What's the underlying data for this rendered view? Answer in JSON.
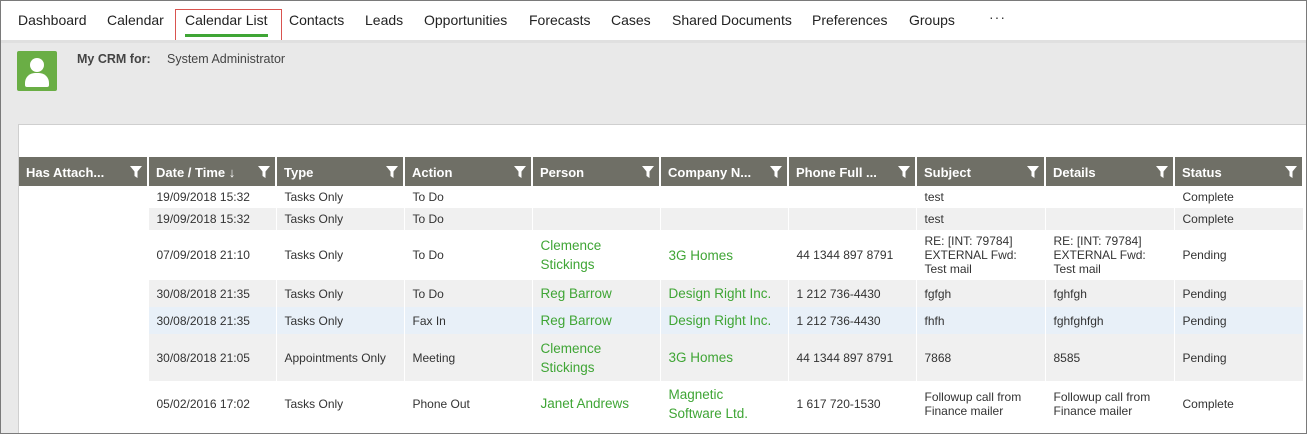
{
  "nav": {
    "items": [
      {
        "label": "Dashboard"
      },
      {
        "label": "Calendar"
      },
      {
        "label": "Calendar List"
      },
      {
        "label": "Contacts"
      },
      {
        "label": "Leads"
      },
      {
        "label": "Opportunities"
      },
      {
        "label": "Forecasts"
      },
      {
        "label": "Cases"
      },
      {
        "label": "Shared Documents"
      },
      {
        "label": "Preferences"
      },
      {
        "label": "Groups"
      }
    ],
    "more": "···",
    "active_color": "#3fa535"
  },
  "header": {
    "crm_label": "My CRM for:",
    "user_name": "System Administrator",
    "avatar_color": "#6aae45"
  },
  "table": {
    "columns": [
      {
        "label": "Has Attach..."
      },
      {
        "label": "Date / Time ↓"
      },
      {
        "label": "Type"
      },
      {
        "label": "Action"
      },
      {
        "label": "Person"
      },
      {
        "label": "Company N..."
      },
      {
        "label": "Phone Full ..."
      },
      {
        "label": "Subject"
      },
      {
        "label": "Details"
      },
      {
        "label": "Status"
      }
    ],
    "rows": [
      {
        "date": "19/09/2018 15:32",
        "type": "Tasks Only",
        "action": "To Do",
        "person": "",
        "company": "",
        "phone": "",
        "subject": "test",
        "details": "",
        "status": "Complete"
      },
      {
        "date": "19/09/2018 15:32",
        "type": "Tasks Only",
        "action": "To Do",
        "person": "",
        "company": "",
        "phone": "",
        "subject": "test",
        "details": "",
        "status": "Complete"
      },
      {
        "date": "07/09/2018 21:10",
        "type": "Tasks Only",
        "action": "To Do",
        "person": "Clemence Stickings",
        "company": "3G Homes",
        "phone": "44 1344 897 8791",
        "subject": "RE: [INT: 79784] EXTERNAL Fwd: Test mail",
        "details": "RE: [INT: 79784] EXTERNAL Fwd: Test mail",
        "status": "Pending"
      },
      {
        "date": "30/08/2018 21:35",
        "type": "Tasks Only",
        "action": "To Do",
        "person": "Reg Barrow",
        "company": "Design Right Inc.",
        "phone": "1 212 736-4430",
        "subject": "fgfgh",
        "details": "fghfgh",
        "status": "Pending"
      },
      {
        "date": "30/08/2018 21:35",
        "type": "Tasks Only",
        "action": "Fax In",
        "person": "Reg Barrow",
        "company": "Design Right Inc.",
        "phone": "1 212 736-4430",
        "subject": "fhfh",
        "details": "fghfghfgh",
        "status": "Pending"
      },
      {
        "date": "30/08/2018 21:05",
        "type": "Appointments Only",
        "action": "Meeting",
        "person": "Clemence Stickings",
        "company": "3G Homes",
        "phone": "44 1344 897 8791",
        "subject": "7868",
        "details": "8585",
        "status": "Pending"
      },
      {
        "date": "05/02/2016 17:02",
        "type": "Tasks Only",
        "action": "Phone Out",
        "person": "Janet Andrews",
        "company": "Magnetic Software Ltd.",
        "phone": "1 617 720-1530",
        "subject": "Followup call from Finance mailer",
        "details": "Followup call from Finance mailer",
        "status": "Complete"
      }
    ]
  }
}
